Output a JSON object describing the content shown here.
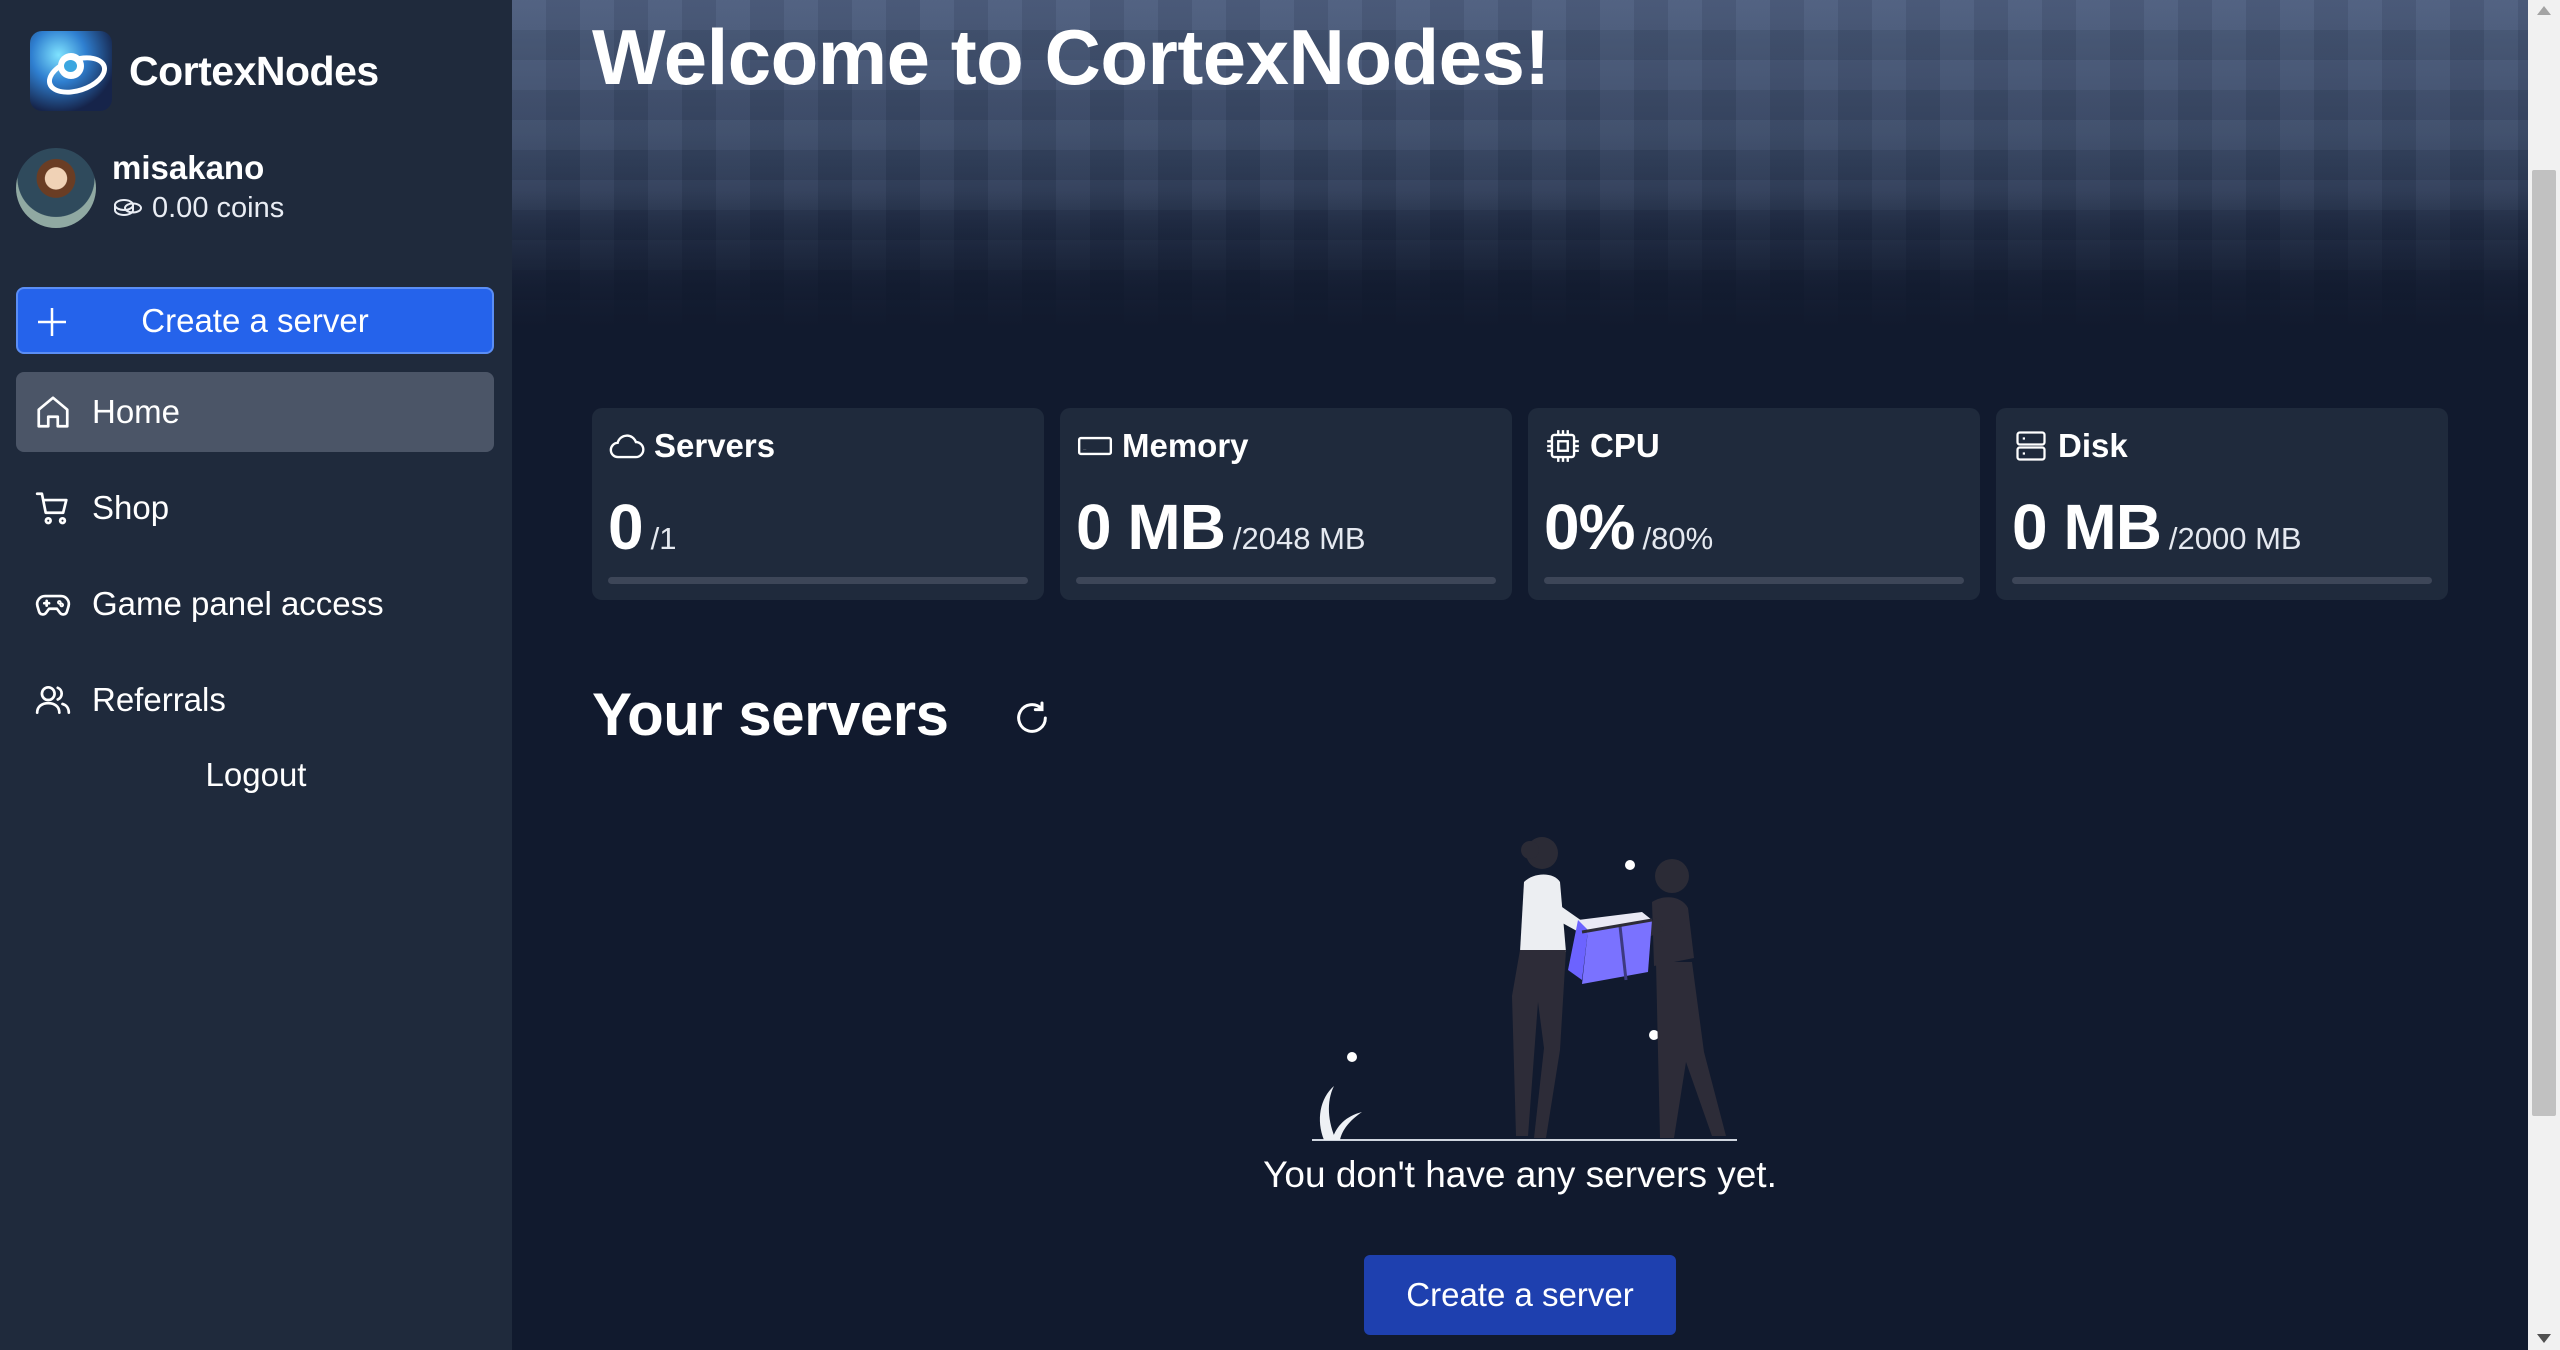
{
  "brand": {
    "name": "CortexNodes",
    "logo_icon": "planet-logo-icon"
  },
  "user": {
    "username": "misakano",
    "coins": "0.00 coins"
  },
  "sidebar": {
    "create_label": "Create a server",
    "items": [
      {
        "label": "Home",
        "icon": "home-icon",
        "active": true
      },
      {
        "label": "Shop",
        "icon": "cart-icon"
      },
      {
        "label": "Game panel access",
        "icon": "gamepad-icon"
      },
      {
        "label": "Referrals",
        "icon": "users-icon"
      }
    ],
    "logout_label": "Logout"
  },
  "main": {
    "welcome": "Welcome to CortexNodes!",
    "stats": [
      {
        "title": "Servers",
        "icon": "cloud-icon",
        "value": "0",
        "limit": "/1",
        "usage_fraction": 0
      },
      {
        "title": "Memory",
        "icon": "memory-icon",
        "value": "0 MB",
        "limit": "/2048 MB",
        "usage_fraction": 0
      },
      {
        "title": "CPU",
        "icon": "cpu-icon",
        "value": "0%",
        "limit": "/80%",
        "usage_fraction": 0
      },
      {
        "title": "Disk",
        "icon": "disk-icon",
        "value": "0 MB",
        "limit": "/2000 MB",
        "usage_fraction": 0
      }
    ],
    "servers_title": "Your servers",
    "empty_message": "You don't have any servers yet.",
    "create_label": "Create a server"
  },
  "colors": {
    "accent": "#2563eb",
    "sidebar_bg": "#1f2a3c",
    "page_bg": "#111a2e",
    "button_dark": "#1e40af"
  }
}
